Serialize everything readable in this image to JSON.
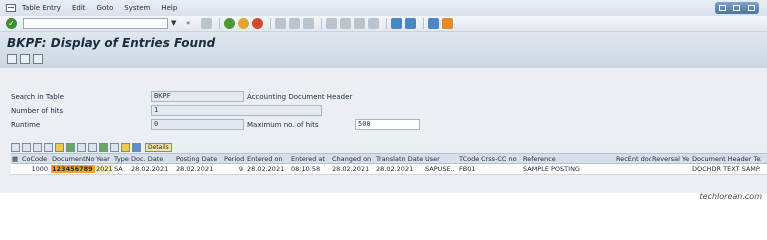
{
  "menu": {
    "items": [
      "Table Entry",
      "Edit",
      "Goto",
      "System",
      "Help"
    ]
  },
  "toolbar": {
    "command_field": "",
    "icons": [
      "enter-icon",
      "back-icon",
      "save-icon",
      "green-back-icon",
      "exit-icon",
      "cancel-icon",
      "print-icon",
      "find-icon",
      "find-next-icon",
      "first-page-icon",
      "prev-page-icon",
      "next-page-icon",
      "last-page-icon",
      "new-session-icon",
      "shortcut-icon",
      "help-icon",
      "customize-icon"
    ]
  },
  "title": "BKPF: Display of Entries Found",
  "selection": {
    "search_label": "Search in Table",
    "search_value": "BKPF",
    "search_desc": "Accounting Document Header",
    "hits_label": "Number of hits",
    "hits_value": "1",
    "runtime_label": "Runtime",
    "runtime_value": "0",
    "max_hits_label": "Maximum no. of hits",
    "max_hits_value": "500"
  },
  "grid": {
    "details_label": "Details",
    "headers": [
      "CoCode",
      "DocumentNo",
      "Year",
      "Type",
      "Doc. Date",
      "Posting Date",
      "Period",
      "Entered on",
      "Entered at",
      "Changed on",
      "Translatn Date",
      "User",
      "TCode",
      "Crss-CC no",
      "Reference",
      "RecEnt doc",
      "Reversal",
      "Ye",
      "Document Header Text"
    ],
    "row": [
      "1000",
      "123456789",
      "2021",
      "SA",
      "28.02.2021",
      "28.02.2021",
      "9",
      "28.02.2021",
      "08:10:58",
      "28.02.2021",
      "28.02.2021",
      "SAPUSE..",
      "FB01",
      "",
      "SAMPLE POSTING",
      "",
      "",
      "",
      "DOCHDR TEXT SAMP..."
    ]
  },
  "watermark": "techlorean.com"
}
